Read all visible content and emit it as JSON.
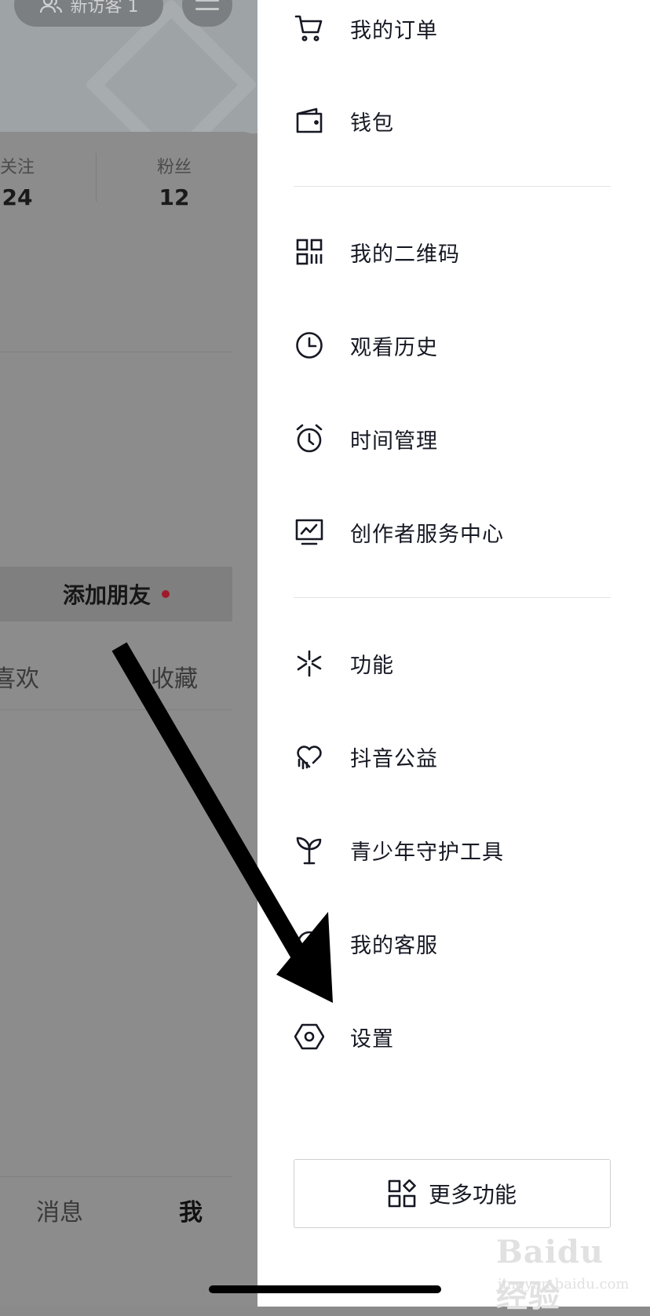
{
  "profile": {
    "visitor_label": "新访客 1",
    "stats": [
      {
        "label": "关注",
        "value": "24"
      },
      {
        "label": "粉丝",
        "value": "12"
      }
    ],
    "add_friend_label": "添加朋友",
    "tabs": [
      "喜欢",
      "收藏"
    ],
    "bottom_tabs": [
      "消息",
      "我"
    ]
  },
  "drawer": {
    "items": [
      {
        "label": "我的订单",
        "icon": "cart-icon"
      },
      {
        "label": "钱包",
        "icon": "wallet-icon"
      },
      {
        "label": "我的二维码",
        "icon": "qr-code-icon"
      },
      {
        "label": "观看历史",
        "icon": "clock-icon"
      },
      {
        "label": "时间管理",
        "icon": "alarm-icon"
      },
      {
        "label": "创作者服务中心",
        "icon": "monitor-chart-icon"
      },
      {
        "label": "功能",
        "icon": "sparkle-icon"
      },
      {
        "label": "抖音公益",
        "icon": "heart-rain-icon"
      },
      {
        "label": "青少年守护工具",
        "icon": "sprout-icon"
      },
      {
        "label": "我的客服",
        "icon": "headset-icon"
      },
      {
        "label": "设置",
        "icon": "hexagon-gear-icon"
      }
    ],
    "more_label": "更多功能"
  },
  "watermark": {
    "brand": "Baidu经验",
    "url": "jingyan.baidu.com"
  }
}
